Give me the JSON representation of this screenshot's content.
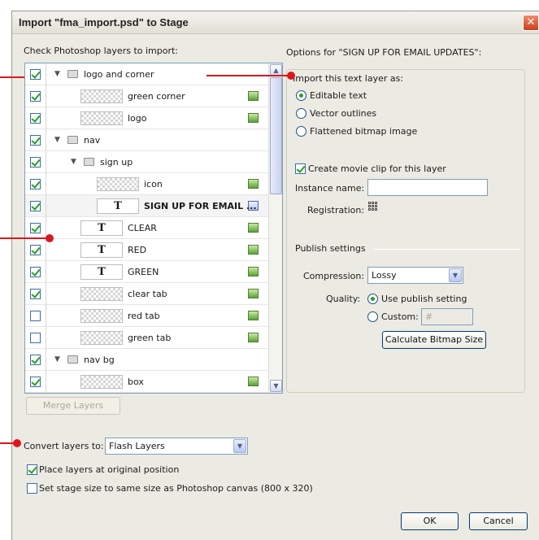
{
  "dialog": {
    "title": "Import \"fma_import.psd\" to Stage",
    "close_glyph": "✕"
  },
  "layers": {
    "header": "Check Photoshop layers to import:",
    "rows": [
      {
        "name": "logo and corner",
        "checked": true,
        "type": "folder",
        "indent": 0
      },
      {
        "name": "green corner",
        "checked": true,
        "type": "bitmap",
        "indent": 1
      },
      {
        "name": "logo",
        "checked": true,
        "type": "bitmap",
        "indent": 1
      },
      {
        "name": "nav",
        "checked": true,
        "type": "folder",
        "indent": 0
      },
      {
        "name": "sign up",
        "checked": true,
        "type": "folder",
        "indent": 1
      },
      {
        "name": "icon",
        "checked": true,
        "type": "bitmap",
        "indent": 2
      },
      {
        "name": "SIGN UP FOR EMAIL ...",
        "checked": true,
        "type": "text",
        "indent": 2,
        "selected": true
      },
      {
        "name": "CLEAR",
        "checked": true,
        "type": "text",
        "indent": 1
      },
      {
        "name": "RED",
        "checked": true,
        "type": "text",
        "indent": 1
      },
      {
        "name": "GREEN",
        "checked": true,
        "type": "text",
        "indent": 1
      },
      {
        "name": "clear tab",
        "checked": true,
        "type": "bitmap",
        "indent": 1
      },
      {
        "name": "red tab",
        "checked": false,
        "type": "bitmap",
        "indent": 1
      },
      {
        "name": "green tab",
        "checked": false,
        "type": "bitmap",
        "indent": 1
      },
      {
        "name": "nav bg",
        "checked": true,
        "type": "folder",
        "indent": 0
      },
      {
        "name": "box",
        "checked": true,
        "type": "bitmap",
        "indent": 1
      }
    ],
    "text_glyph": "T",
    "merge_label": "Merge Layers"
  },
  "options": {
    "header": "Options for \"SIGN UP FOR EMAIL UPDATES\":",
    "import_as_label": "Import this text layer as:",
    "radio_editable": "Editable text",
    "radio_vector": "Vector outlines",
    "radio_bitmap": "Flattened bitmap image",
    "movie_clip_label": "Create movie clip for this layer",
    "instance_label": "Instance name:",
    "instance_value": "",
    "registration_label": "Registration:",
    "publish_header": "Publish settings",
    "compression_label": "Compression:",
    "compression_value": "Lossy",
    "quality_label": "Quality:",
    "quality_publish": "Use publish setting",
    "quality_custom": "Custom:",
    "custom_value": "#",
    "calc_button": "Calculate Bitmap Size"
  },
  "bottom": {
    "convert_label": "Convert layers to:",
    "convert_value": "Flash Layers",
    "place_label": "Place layers at original position",
    "stage_label": "Set stage size to same size as Photoshop canvas (800 x 320)",
    "ok": "OK",
    "cancel": "Cancel"
  },
  "colors": {
    "callout": "#d9181e",
    "dialog_bg": "#ecebe3",
    "check_green": "#21a121"
  }
}
